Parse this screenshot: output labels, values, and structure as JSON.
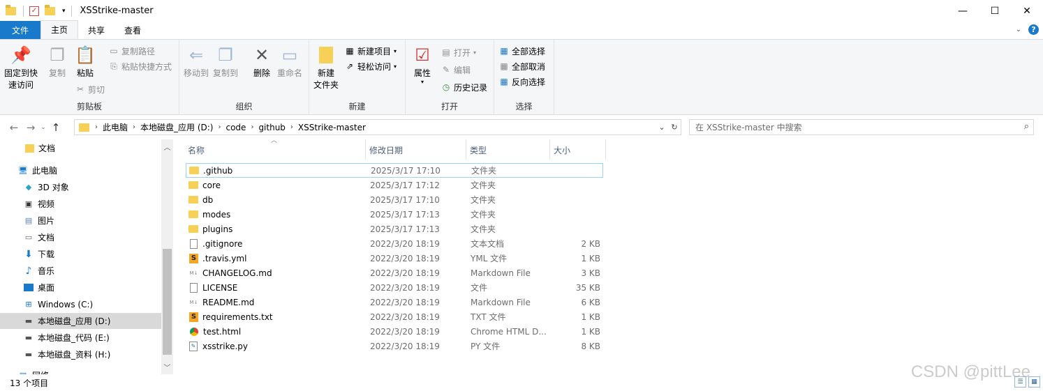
{
  "window": {
    "title": "XSStrike-master",
    "controls": {
      "minimize": "—",
      "maximize": "☐",
      "close": "✕"
    }
  },
  "ribbon_tabs": [
    "文件",
    "主页",
    "共享",
    "查看"
  ],
  "ribbon": {
    "clipboard": {
      "label": "剪贴板",
      "pin": "固定到快\n速访问",
      "copy": "复制",
      "paste": "粘贴",
      "copy_path": "复制路径",
      "paste_shortcut": "粘贴快捷方式",
      "cut": "剪切"
    },
    "organize": {
      "label": "组织",
      "move_to": "移动到",
      "copy_to": "复制到",
      "delete": "删除",
      "rename": "重命名"
    },
    "new": {
      "label": "新建",
      "new_folder": "新建\n文件夹",
      "new_item": "新建项目",
      "easy_access": "轻松访问"
    },
    "open": {
      "label": "打开",
      "properties": "属性",
      "open": "打开",
      "edit": "编辑",
      "history": "历史记录"
    },
    "select": {
      "label": "选择",
      "select_all": "全部选择",
      "select_none": "全部取消",
      "invert": "反向选择"
    }
  },
  "address": {
    "crumbs": [
      "此电脑",
      "本地磁盘_应用 (D:)",
      "code",
      "github",
      "XSStrike-master"
    ],
    "search_placeholder": "在 XSStrike-master 中搜索"
  },
  "nav": {
    "items": [
      {
        "label": "文档",
        "icon": "folder-icon"
      },
      {
        "label": "此电脑",
        "icon": "computer-icon"
      },
      {
        "label": "3D 对象",
        "icon": "cube-icon"
      },
      {
        "label": "视频",
        "icon": "video-icon"
      },
      {
        "label": "图片",
        "icon": "picture-icon"
      },
      {
        "label": "文档",
        "icon": "document-icon"
      },
      {
        "label": "下载",
        "icon": "download-icon"
      },
      {
        "label": "音乐",
        "icon": "music-icon"
      },
      {
        "label": "桌面",
        "icon": "desktop-icon"
      },
      {
        "label": "Windows (C:)",
        "icon": "drive-icon"
      },
      {
        "label": "本地磁盘_应用 (D:)",
        "icon": "drive-icon"
      },
      {
        "label": "本地磁盘_代码 (E:)",
        "icon": "drive-icon"
      },
      {
        "label": "本地磁盘_资料 (H:)",
        "icon": "drive-icon"
      },
      {
        "label": "网络",
        "icon": "network-icon"
      }
    ]
  },
  "files": {
    "columns": [
      "名称",
      "修改日期",
      "类型",
      "大小"
    ],
    "rows": [
      {
        "name": ".github",
        "date": "2025/3/17 17:10",
        "type": "文件夹",
        "size": "",
        "icon": "folder"
      },
      {
        "name": "core",
        "date": "2025/3/17 17:12",
        "type": "文件夹",
        "size": "",
        "icon": "folder"
      },
      {
        "name": "db",
        "date": "2025/3/17 17:10",
        "type": "文件夹",
        "size": "",
        "icon": "folder"
      },
      {
        "name": "modes",
        "date": "2025/3/17 17:13",
        "type": "文件夹",
        "size": "",
        "icon": "folder"
      },
      {
        "name": "plugins",
        "date": "2025/3/17 17:13",
        "type": "文件夹",
        "size": "",
        "icon": "folder"
      },
      {
        "name": ".gitignore",
        "date": "2022/3/20 18:19",
        "type": "文本文档",
        "size": "2 KB",
        "icon": "doc"
      },
      {
        "name": ".travis.yml",
        "date": "2022/3/20 18:19",
        "type": "YML 文件",
        "size": "1 KB",
        "icon": "sub"
      },
      {
        "name": "CHANGELOG.md",
        "date": "2022/3/20 18:19",
        "type": "Markdown File",
        "size": "3 KB",
        "icon": "md"
      },
      {
        "name": "LICENSE",
        "date": "2022/3/20 18:19",
        "type": "文件",
        "size": "35 KB",
        "icon": "doc"
      },
      {
        "name": "README.md",
        "date": "2022/3/20 18:19",
        "type": "Markdown File",
        "size": "6 KB",
        "icon": "md"
      },
      {
        "name": "requirements.txt",
        "date": "2022/3/20 18:19",
        "type": "TXT 文件",
        "size": "1 KB",
        "icon": "sub"
      },
      {
        "name": "test.html",
        "date": "2022/3/20 18:19",
        "type": "Chrome HTML D...",
        "size": "1 KB",
        "icon": "chrome"
      },
      {
        "name": "xsstrike.py",
        "date": "2022/3/20 18:19",
        "type": "PY 文件",
        "size": "8 KB",
        "icon": "py"
      }
    ]
  },
  "status": {
    "count": "13 个项目"
  },
  "watermark": "CSDN @pittLee"
}
